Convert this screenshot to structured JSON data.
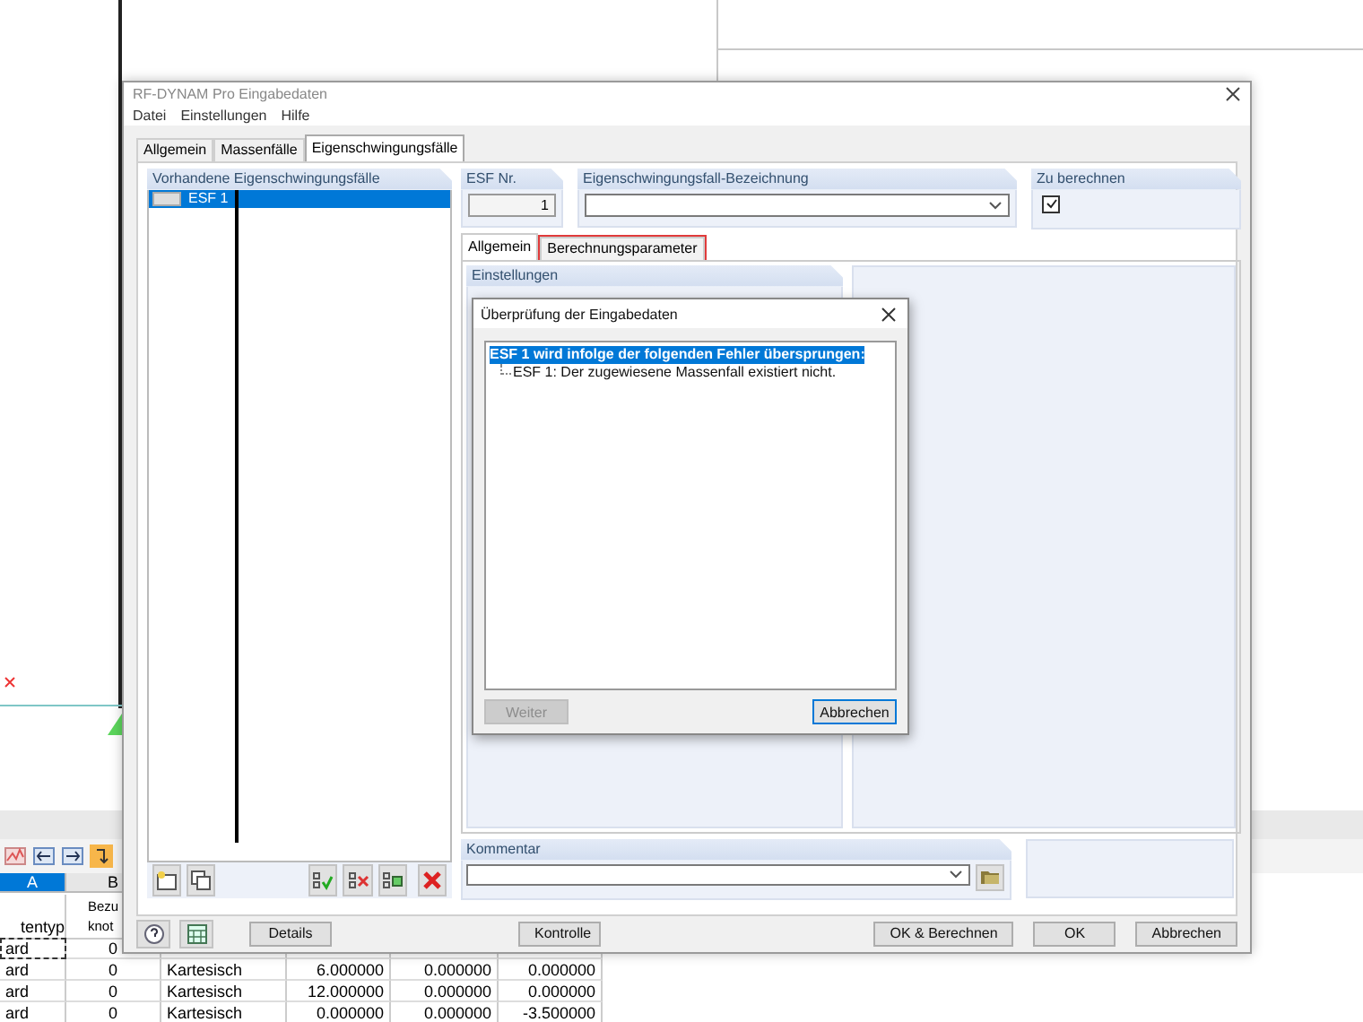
{
  "workspace": {
    "table": {
      "columns": [
        {
          "label": "A",
          "selected": true,
          "subheader": [
            "tentyp"
          ]
        },
        {
          "label": "B",
          "selected": false,
          "subheader": [
            "Bezu",
            "knot"
          ]
        }
      ],
      "rows": [
        {
          "cells": [
            "ard",
            "0"
          ],
          "focused": true
        },
        {
          "cells": [
            "ard",
            "0",
            "Kartesisch",
            "6.000000",
            "0.000000",
            "0.000000"
          ],
          "focused": false
        },
        {
          "cells": [
            "ard",
            "0",
            "Kartesisch",
            "12.000000",
            "0.000000",
            "0.000000"
          ],
          "focused": false
        },
        {
          "cells": [
            "ard",
            "0",
            "Kartesisch",
            "0.000000",
            "0.000000",
            "-3.500000"
          ],
          "focused": false
        }
      ]
    }
  },
  "window": {
    "title": "RF-DYNAM Pro Eingabedaten"
  },
  "menu": [
    "Datei",
    "Einstellungen",
    "Hilfe"
  ],
  "tabs": [
    {
      "label": "Allgemein",
      "selected": false
    },
    {
      "label": "Massenfälle",
      "selected": false
    },
    {
      "label": "Eigenschwingungsfälle",
      "selected": true
    }
  ],
  "case_list": {
    "title": "Vorhandene Eigenschwingungsfälle",
    "items": [
      {
        "label": "ESF 1",
        "selected": true
      }
    ]
  },
  "esf_number": {
    "label": "ESF Nr.",
    "value": "1"
  },
  "description": {
    "label": "Eigenschwingungsfall-Bezeichnung"
  },
  "to_calculate": {
    "label": "Zu berechnen",
    "checked": true
  },
  "subtabs": [
    {
      "label": "Allgemein",
      "selected": true,
      "highlighted": false
    },
    {
      "label": "Berechnungsparameter",
      "selected": false,
      "highlighted": true
    }
  ],
  "settings": {
    "title": "Einstellungen"
  },
  "comment": {
    "label": "Kommentar"
  },
  "buttons": [
    {
      "label": "Details",
      "kind": "left"
    },
    {
      "label": "Kontrolle",
      "kind": "center"
    },
    {
      "label": "OK & Berechnen",
      "kind": "right"
    },
    {
      "label": "OK",
      "kind": "right"
    },
    {
      "label": "Abbrechen",
      "kind": "right"
    }
  ],
  "check_dialog": {
    "title": "Überprüfung der Eingabedaten",
    "tree": [
      {
        "label": "ESF 1 wird infolge der folgenden Fehler übersprungen:",
        "selected": true,
        "children": [
          {
            "label": "ESF 1: Der zugewiesene Massenfall existiert nicht.",
            "selected": false
          }
        ]
      }
    ],
    "buttons": [
      {
        "label": "Weiter",
        "disabled": true,
        "default": false
      },
      {
        "label": "Abbrechen",
        "disabled": false,
        "default": true
      }
    ]
  }
}
